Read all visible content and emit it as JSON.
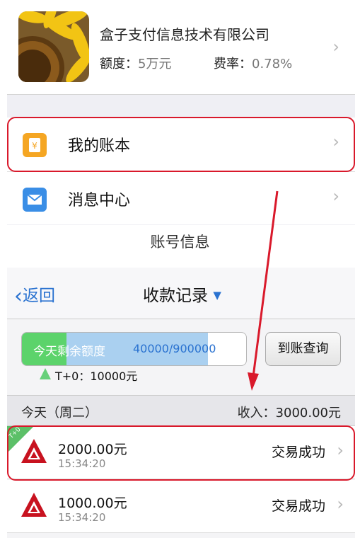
{
  "merchant": {
    "name": "盒子支付信息技术有限公司",
    "limit_label": "额度：",
    "limit_value": "5万元",
    "fee_label": "费率：",
    "fee_value": "0.78%"
  },
  "menu": [
    {
      "label": "我的账本",
      "icon": "ledger-icon"
    },
    {
      "label": "消息中心",
      "icon": "mail-icon"
    }
  ],
  "caption": "账号信息",
  "nav": {
    "back_label": "返回",
    "title": "收款记录"
  },
  "quota": {
    "label": "今天剩余额度",
    "value": "40000/900000",
    "fill_green_fraction": 0.2,
    "fill_blue_fraction": 0.83
  },
  "arrive_button": "到账查询",
  "t0_text": "T+0：10000元",
  "date_bar": {
    "left": "今天（周二）",
    "right": "收入：3000.00元"
  },
  "records": [
    {
      "amount": "2000.00元",
      "time": "15:34:20",
      "status": "交易成功",
      "badge": "T+0"
    },
    {
      "amount": "1000.00元",
      "time": "15:34:20",
      "status": "交易成功"
    }
  ],
  "colors": {
    "accent_red": "#d9192b",
    "link_blue": "#2a72d0",
    "green": "#5cd36b"
  }
}
